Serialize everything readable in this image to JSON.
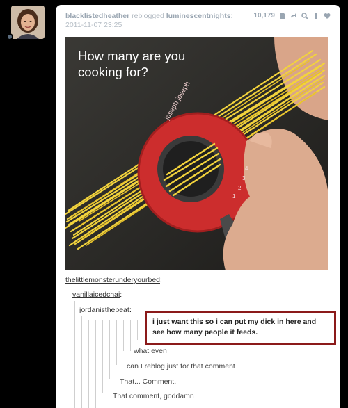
{
  "post": {
    "reblogger": "blacklistedheather",
    "reblogged_text": "reblogged",
    "source": "luminescentnights",
    "source_suffix": ":",
    "timestamp": "2011-11-07 23:25",
    "notes": "10,179"
  },
  "photo": {
    "line1": "How many are you",
    "line2": "cooking for?",
    "brand": "joseph joseph",
    "dial_numbers": [
      "1",
      "2",
      "3",
      "4"
    ]
  },
  "thread": {
    "user1": "thelittlemonsterunderyourbed",
    "user2": "vanillaicedchai",
    "user3": "jordanisthebeat",
    "colon": ":",
    "comment_highlight": "i just want this so i can put my dick in here and see how many people it feeds.",
    "comment_what_even": "what even",
    "comment_reblog": "can I reblog just for that comment",
    "comment_that": "That... Comment.",
    "comment_goddamn": "That comment, goddamn"
  },
  "colors": {
    "background": "#000000",
    "card": "#ffffff",
    "highlight_border": "#8b1a1a",
    "link": "#9aa6b2"
  }
}
